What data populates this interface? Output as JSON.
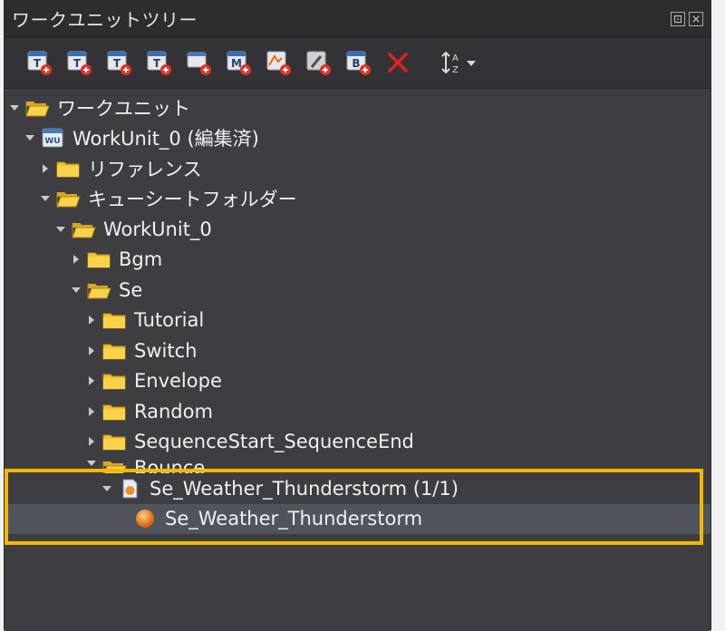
{
  "panel": {
    "title": "ワークユニットツリー",
    "float_btn": "⊡",
    "close_btn": "×"
  },
  "toolbar": {
    "tools": [
      {
        "name": "add-t-tool-1",
        "letter": "T"
      },
      {
        "name": "add-t-tool-2",
        "letter": "T"
      },
      {
        "name": "add-t-tool-3",
        "letter": "T"
      },
      {
        "name": "add-t-tool-4",
        "letter": "T"
      },
      {
        "name": "add-window-tool",
        "letter": ""
      },
      {
        "name": "add-m-tool",
        "letter": "M"
      },
      {
        "name": "add-envelope-tool",
        "letter": ""
      },
      {
        "name": "add-edit-tool",
        "letter": ""
      },
      {
        "name": "add-b-tool",
        "letter": "B"
      }
    ]
  },
  "tree": {
    "items": [
      {
        "label": "ワークユニット",
        "depth": 0,
        "expanded": true,
        "icon": "folder-open"
      },
      {
        "label": "WorkUnit_0 (編集済)",
        "depth": 1,
        "expanded": true,
        "icon": "workunit",
        "icon_text": "WU"
      },
      {
        "label": "リファレンス",
        "depth": 2,
        "expanded": false,
        "icon": "folder"
      },
      {
        "label": "キューシートフォルダー",
        "depth": 2,
        "expanded": true,
        "icon": "folder-open"
      },
      {
        "label": "WorkUnit_0",
        "depth": 3,
        "expanded": true,
        "icon": "folder-open"
      },
      {
        "label": "Bgm",
        "depth": 4,
        "expanded": false,
        "icon": "folder"
      },
      {
        "label": "Se",
        "depth": 4,
        "expanded": true,
        "icon": "folder-open"
      },
      {
        "label": "Tutorial",
        "depth": 5,
        "expanded": false,
        "icon": "folder"
      },
      {
        "label": "Switch",
        "depth": 5,
        "expanded": false,
        "icon": "folder"
      },
      {
        "label": "Envelope",
        "depth": 5,
        "expanded": false,
        "icon": "folder"
      },
      {
        "label": "Random",
        "depth": 5,
        "expanded": false,
        "icon": "folder"
      },
      {
        "label": "SequenceStart_SequenceEnd",
        "depth": 5,
        "expanded": false,
        "icon": "folder"
      },
      {
        "label": "Bounce",
        "depth": 5,
        "expanded": true,
        "icon": "folder-open"
      },
      {
        "label": "Se_Weather_Thunderstorm (1/1)",
        "depth": 6,
        "expanded": true,
        "icon": "cuesheet"
      },
      {
        "label": "Se_Weather_Thunderstorm",
        "depth": 7,
        "expanded": null,
        "icon": "cue",
        "selected": true
      }
    ]
  },
  "colors": {
    "highlight": "#f5b800",
    "folder": "#f2c230",
    "delete": "#e02020"
  }
}
